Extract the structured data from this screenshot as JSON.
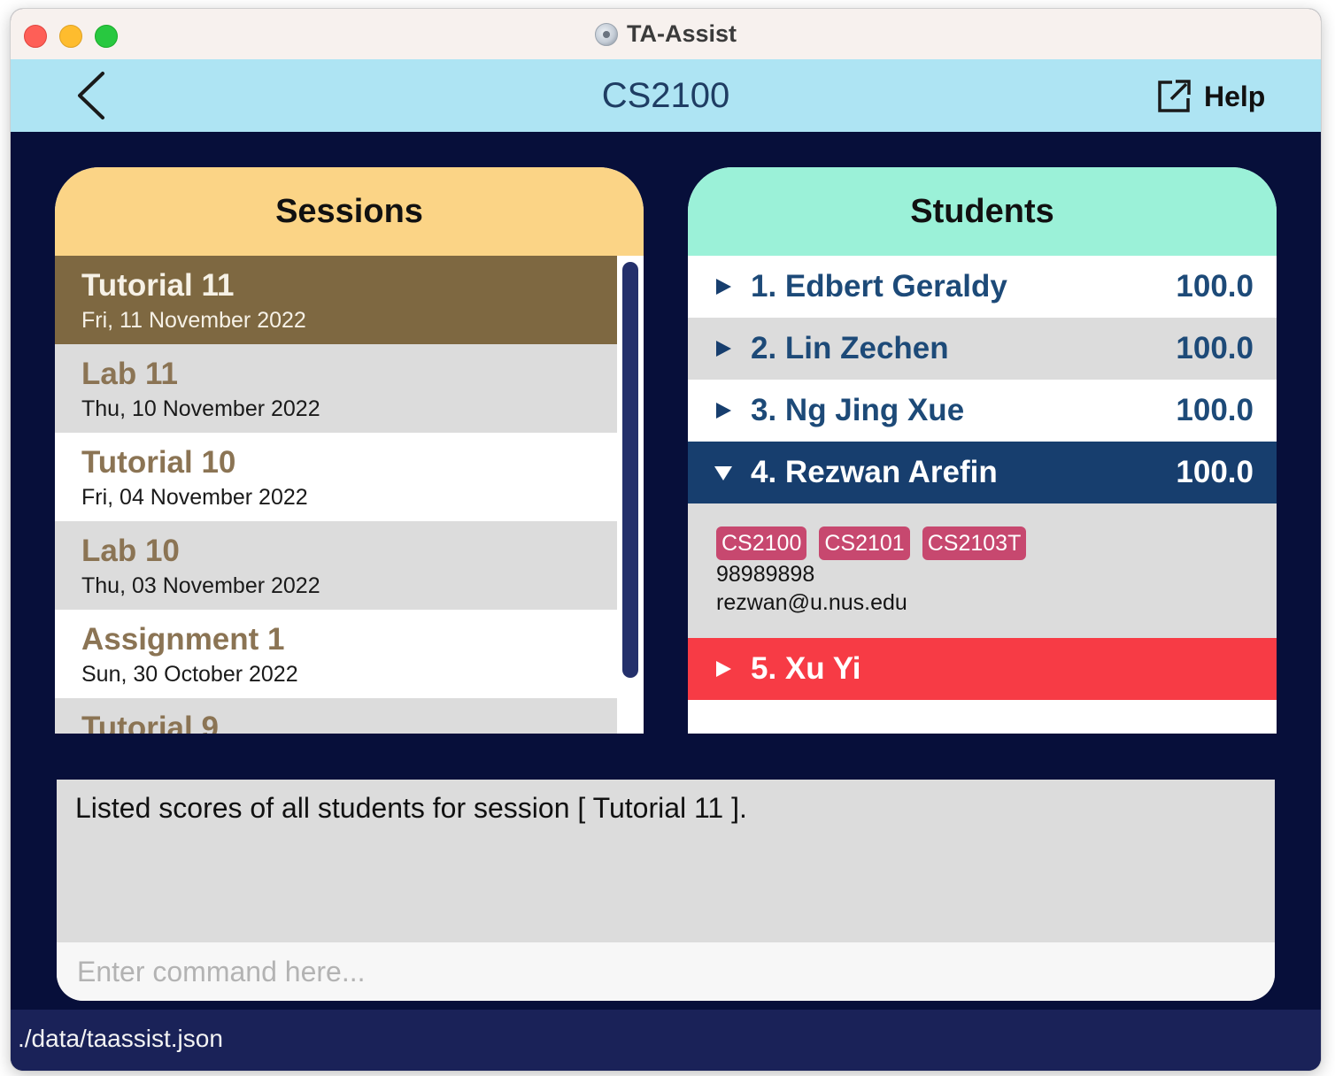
{
  "window": {
    "title": "TA-Assist"
  },
  "header": {
    "course": "CS2100",
    "help_label": "Help"
  },
  "sessions": {
    "title": "Sessions",
    "items": [
      {
        "name": "Tutorial 11",
        "date": "Fri, 11 November 2022",
        "selected": true
      },
      {
        "name": "Lab 11",
        "date": "Thu, 10 November 2022"
      },
      {
        "name": "Tutorial 10",
        "date": "Fri, 04 November 2022"
      },
      {
        "name": "Lab 10",
        "date": "Thu, 03 November 2022"
      },
      {
        "name": "Assignment 1",
        "date": "Sun, 30 October 2022"
      },
      {
        "name": "Tutorial 9",
        "date": ""
      }
    ]
  },
  "students": {
    "title": "Students",
    "items": [
      {
        "name": "1. Edbert Geraldy",
        "score": "100.0"
      },
      {
        "name": "2. Lin Zechen",
        "score": "100.0"
      },
      {
        "name": "3. Ng Jing Xue",
        "score": "100.0"
      },
      {
        "name": "4. Rezwan Arefin",
        "score": "100.0",
        "expanded": true,
        "tags": [
          "CS2100",
          "CS2101",
          "CS2103T"
        ],
        "phone": "98989898",
        "email": "rezwan@u.nus.edu"
      },
      {
        "name": "5. Xu Yi",
        "score": "",
        "flagged": true
      }
    ]
  },
  "result": {
    "text": "Listed scores of all students for session [ Tutorial 11 ]."
  },
  "command": {
    "placeholder": "Enter command here...",
    "value": ""
  },
  "status": {
    "file_path": "./data/taassist.json"
  },
  "icons": {
    "back": "chevron-left-icon",
    "help": "external-link-icon",
    "collapsed": "triangle-right-icon",
    "expanded": "triangle-down-icon"
  },
  "colors": {
    "header_bg": "#aee4f3",
    "background": "#070f3a",
    "sessions_header": "#fbd486",
    "students_header": "#9bf1d8",
    "session_selected": "#7e6841",
    "student_expanded": "#173e6e",
    "student_flagged": "#f73b45",
    "tag": "#c7486f",
    "statusbar": "#1a2258"
  }
}
